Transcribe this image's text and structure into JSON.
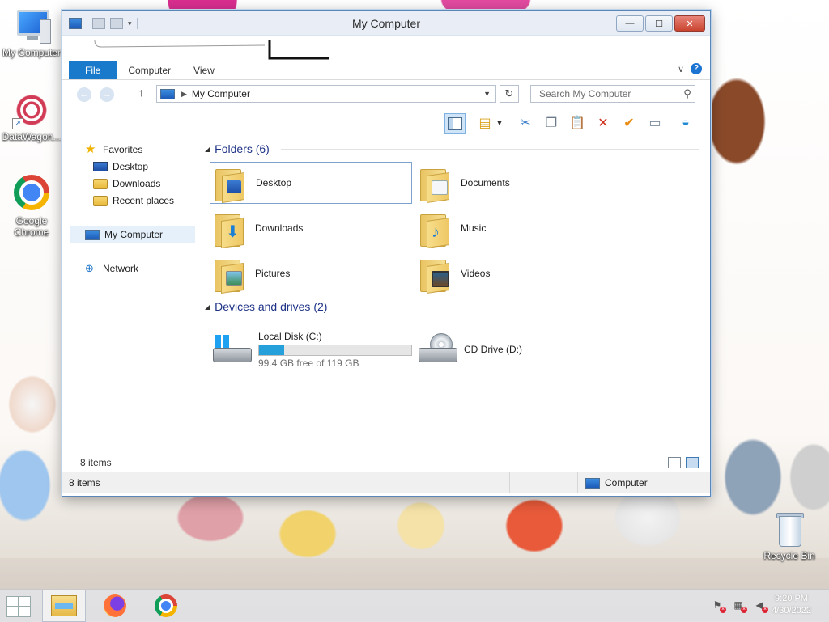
{
  "desktop": {
    "icons": [
      {
        "label": "My Computer"
      },
      {
        "label": "DataWagon..."
      },
      {
        "label": "Google Chrome"
      },
      {
        "label": "Recycle Bin"
      }
    ]
  },
  "window": {
    "title": "My Computer",
    "ribbon_tabs": [
      "File",
      "Computer",
      "View"
    ],
    "address": {
      "path": "My Computer",
      "search_placeholder": "Search My Computer"
    },
    "nav_pane": {
      "favorites": "Favorites",
      "favorites_items": [
        "Desktop",
        "Downloads",
        "Recent places"
      ],
      "my_computer": "My Computer",
      "network": "Network"
    },
    "folders_group": "Folders (6)",
    "folders": [
      "Desktop",
      "Documents",
      "Downloads",
      "Music",
      "Pictures",
      "Videos"
    ],
    "devices_group": "Devices and drives (2)",
    "drives": [
      {
        "name": "Local Disk (C:)",
        "free_text": "99.4 GB free of 119 GB",
        "used_fraction": 0.165
      },
      {
        "name": "CD Drive (D:)"
      }
    ],
    "status_count": "8 items",
    "status_bar_count": "8 items",
    "status_location": "Computer"
  },
  "taskbar": {
    "time": "9:20 PM",
    "date": "4/30/2022"
  },
  "colors": {
    "file_tab": "#1979ca",
    "group_header": "#1e3287",
    "drive_bar": "#26a0da",
    "selection_border": "#7da2ce"
  }
}
